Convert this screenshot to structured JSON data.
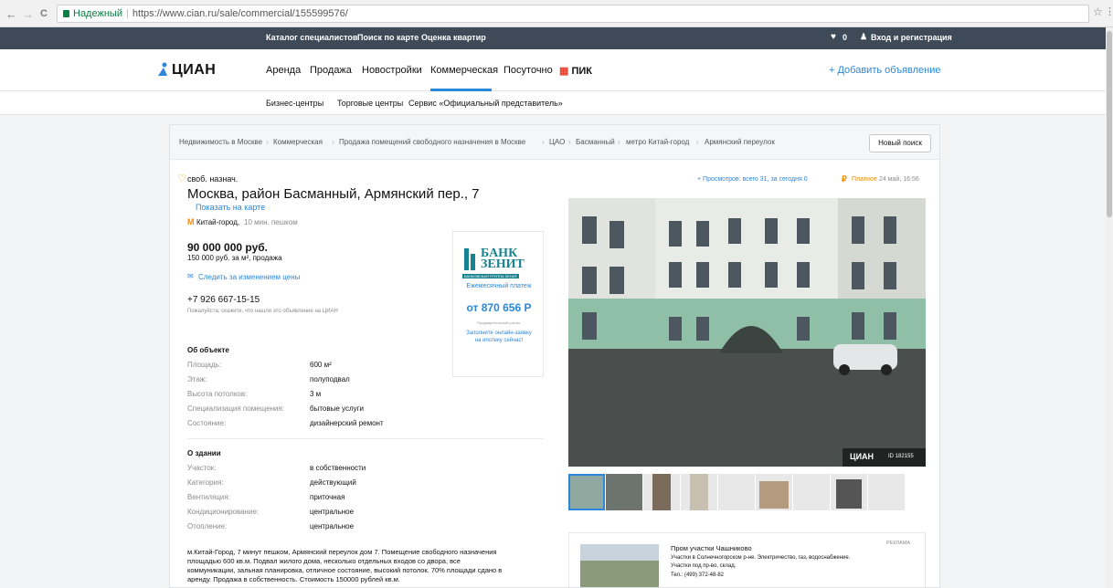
{
  "browser": {
    "back": "←",
    "forward": "→",
    "reload": "C",
    "secure_label": "Надежный",
    "url": "https://www.cian.ru/sale/commercial/155599576/",
    "star": "☆",
    "menu": "⋮"
  },
  "topbar": {
    "links": [
      "Каталог специалистов",
      "Поиск по карте",
      "Оценка квартир"
    ],
    "favorites_count": "0",
    "login": "Вход и регистрация"
  },
  "header": {
    "logo": "ЦИАН",
    "menu": [
      "Аренда",
      "Продажа",
      "Новостройки",
      "Коммерческая",
      "Посуточно",
      "ПИК"
    ],
    "add_ad": "+ Добавить объявление"
  },
  "subnav": [
    "Бизнес-центры",
    "Торговые центры",
    "Сервис «Официальный представитель»"
  ],
  "breadcrumbs": [
    "Недвижимость в Москве",
    "Коммерческая",
    "Продажа помещений свободного назначения в Москве",
    "ЦАО",
    "Басманный",
    "метро Китай-город",
    "Армянский переулок"
  ],
  "new_search": "Новый поиск",
  "listing": {
    "type": "своб. назнач.",
    "address": "Москва, район Басманный, Армянский пер., 7",
    "show_map": "Показать на карте",
    "metro": "Китай-город,",
    "metro_time": "10 мин. пешком",
    "price": "90 000 000 руб.",
    "price_per_m": "150 000 руб. за м², продажа",
    "track_price": "Следить за изменением цены",
    "phone": "+7 926 667-15-15",
    "phone_note": "Пожалуйста, скажите, что нашли это объявление на ЦИАН",
    "views": "+ Просмотров: всего 31, за сегодня 0",
    "paid": "Платное",
    "date": "24 май, 16:56"
  },
  "bank": {
    "name_line1": "БАНК",
    "name_line2": "ЗЕНИТ",
    "group": "БАНКОВСКАЯ ГРУППА ЗЕНИТ",
    "monthly": "Ежемесячный платеж",
    "amount": "от 870 656 Р",
    "note": "Предварительный расчет",
    "cta": "Заполните онлайн-заявку на ипотеку сейчас!"
  },
  "object": {
    "title": "Об объекте",
    "rows": [
      {
        "label": "Площадь:",
        "value": "600 м²"
      },
      {
        "label": "Этаж:",
        "value": "полуподвал"
      },
      {
        "label": "Высота потолков:",
        "value": "3 м"
      },
      {
        "label": "Специализация помещения:",
        "value": "бытовые услуги"
      },
      {
        "label": "Состояние:",
        "value": "дизайнерский ремонт"
      }
    ]
  },
  "building": {
    "title": "О здании",
    "rows": [
      {
        "label": "Участок:",
        "value": "в собственности"
      },
      {
        "label": "Категория:",
        "value": "действующий"
      },
      {
        "label": "Вентиляция:",
        "value": "приточная"
      },
      {
        "label": "Кондиционирование:",
        "value": "центральное"
      },
      {
        "label": "Отопление:",
        "value": "центральное"
      }
    ]
  },
  "description": [
    "м.Китай-Город, 7 минут пешком, Армянский переулок дом 7. Помещение свободного назначения",
    "площадью 600 кв.м. Подвал жилого дома, несколько отдельных входов со двора, все",
    "коммуникации, зальная планировка, отличное состояние, высокий потолок. 70% площади сдано в",
    "аренду. Продажа в собственность. Стоимость 150000 рублей кв.м."
  ],
  "photo": {
    "watermark": "ЦИАН",
    "id": "ID 182155"
  },
  "ad": {
    "label": "РЕКЛАМА",
    "title": "Пром участки Чашниково",
    "text1": "Участки в Солнечногорском р-не. Электричество, газ, водоснабжение.",
    "text2": "Участки под пр-во, склад.",
    "phone": "Тел.: (499) 372-48-82"
  },
  "colors": {
    "accent": "#2b87db",
    "topbar": "#3e4a57",
    "metro": "#f28c00",
    "paid": "#f28c00",
    "bank": "#17838f"
  }
}
